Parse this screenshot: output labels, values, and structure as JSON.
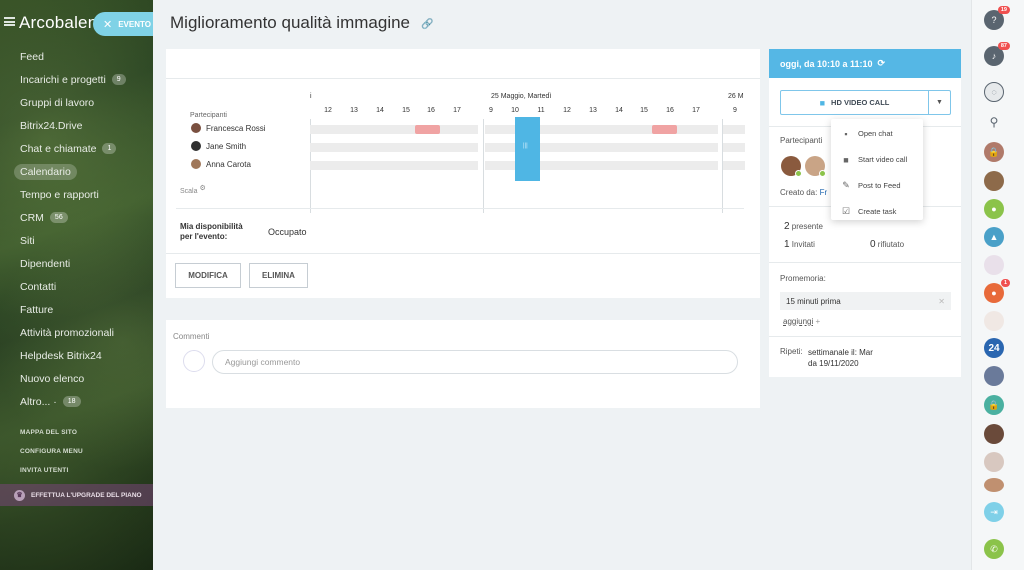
{
  "sidebar": {
    "brand": "Arcobaleno",
    "event_button": "EVENTO",
    "items": [
      {
        "label": "Feed",
        "count": null
      },
      {
        "label": "Incarichi e progetti",
        "count": "9"
      },
      {
        "label": "Gruppi di lavoro",
        "count": null
      },
      {
        "label": "Bitrix24.Drive",
        "count": null
      },
      {
        "label": "Chat e chiamate",
        "count": "1"
      },
      {
        "label": "Calendario",
        "count": null
      },
      {
        "label": "Tempo e rapporti",
        "count": null
      },
      {
        "label": "CRM",
        "count": "56"
      },
      {
        "label": "Siti",
        "count": null
      },
      {
        "label": "Dipendenti",
        "count": null
      },
      {
        "label": "Contatti",
        "count": null
      },
      {
        "label": "Fatture",
        "count": null
      },
      {
        "label": "Attività promozionali",
        "count": null
      },
      {
        "label": "Helpdesk Bitrix24",
        "count": null
      },
      {
        "label": "Nuovo elenco",
        "count": null
      },
      {
        "label": "Altro... ·",
        "count": "18"
      }
    ],
    "small_links": [
      "MAPPA DEL SITO",
      "CONFIGURA MENU",
      "INVITA UTENTI"
    ],
    "upgrade": "EFFETTUA L'UPGRADE DEL PIANO"
  },
  "title": "Miglioramento qualità immagine",
  "schedule": {
    "participants_label": "Partecipanti",
    "participants": [
      "Francesca Rossi",
      "Jane Smith",
      "Anna Carota"
    ],
    "day_labels": [
      "25 Maggio, Martedì",
      "26 M"
    ],
    "hours_day1": [
      "12",
      "13",
      "14",
      "15",
      "16",
      "17"
    ],
    "hours_day2": [
      "9",
      "10",
      "11",
      "12",
      "13",
      "14",
      "15",
      "16",
      "17"
    ],
    "hours_day3": [
      "9"
    ],
    "first_tick": "i",
    "scale_label": "Scala",
    "selection_mark": "|||"
  },
  "availability": {
    "label_line1": "Mia disponibilità",
    "label_line2": "per l'evento:",
    "value": "Occupato"
  },
  "buttons": {
    "modify": "MODIFICA",
    "delete": "ELIMINA"
  },
  "comments": {
    "label": "Commenti",
    "placeholder": "Aggiungi commento"
  },
  "right_panel": {
    "time": "oggi, da 10:10 a 11:10",
    "hd_call": "HD VIDEO CALL",
    "participants_label": "Partecipanti",
    "created_by_label": "Creato da:",
    "created_by_value": "Fr",
    "present_count": "2",
    "present_label": "presente",
    "invited_count": "1",
    "invited_label": "Invitati",
    "refused_count": "0",
    "refused_label": "rifiutato",
    "reminder_label": "Promemoria:",
    "reminder_value": "15 minuti prima",
    "add_label": "aggiungi",
    "repeat_label": "Ripeti:",
    "repeat_value_line1": "settimanale il: Mar",
    "repeat_value_line2": "da 19/11/2020"
  },
  "popup_menu": [
    "Open chat",
    "Start video call",
    "Post to Feed",
    "Create task"
  ],
  "right_bar": {
    "help_badge": "19",
    "notif_badge": "87",
    "user_badge": "1",
    "b24_label": "24"
  },
  "colors": {
    "accent": "#55b7e5",
    "busy": "#f0a3a3",
    "selection": "#4fb6e4",
    "badge": "#f05050",
    "call_green": "#8bc34a"
  }
}
